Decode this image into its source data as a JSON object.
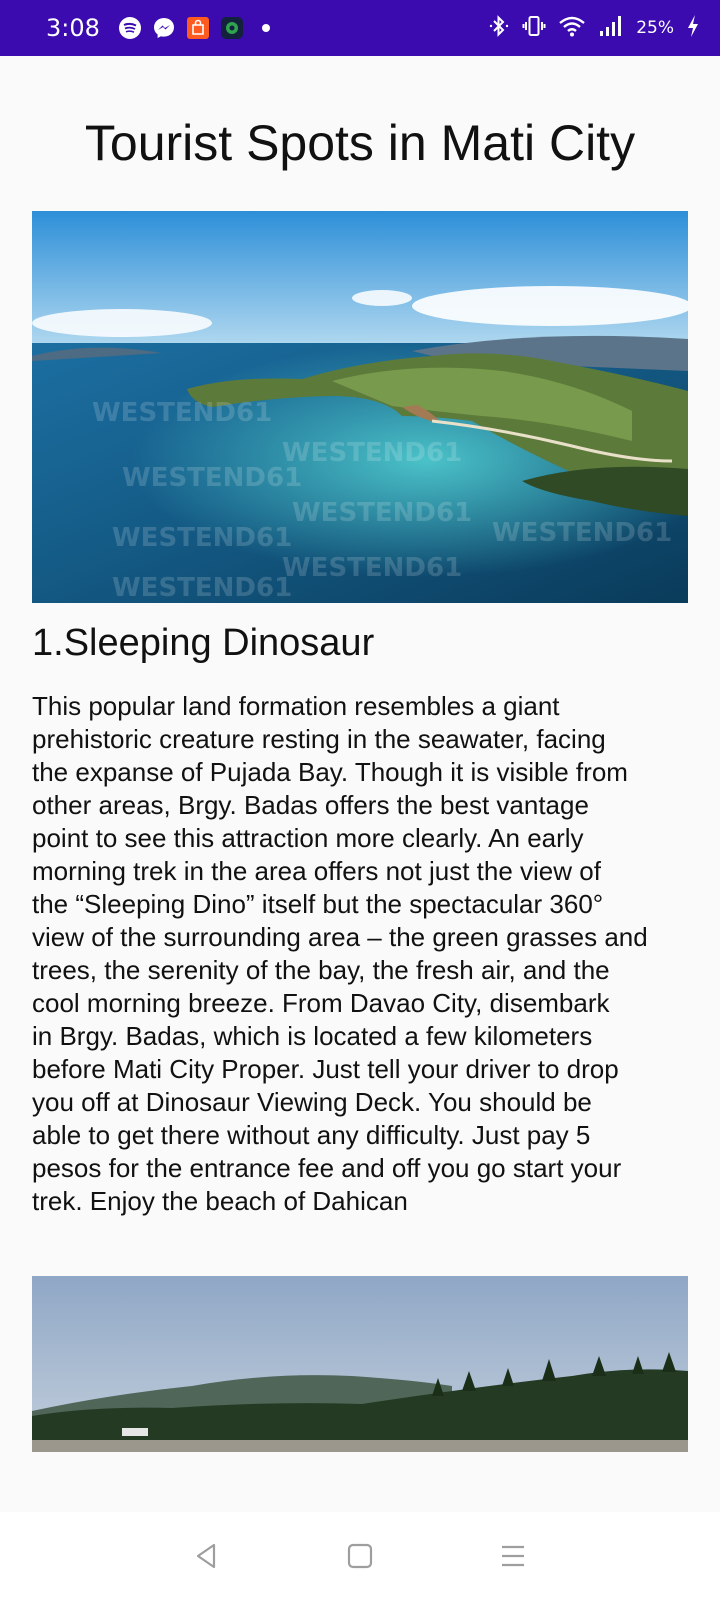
{
  "status_bar": {
    "time": "3:08",
    "battery_percent": "25%",
    "notification_icons": [
      "spotify-icon",
      "messenger-icon",
      "shopping-bag-icon",
      "app-icon",
      "dot-icon"
    ],
    "system_icons": [
      "bluetooth-icon",
      "vibrate-icon",
      "wifi-icon",
      "signal-icon",
      "charging-icon"
    ],
    "background_color": "#3b0bb0"
  },
  "page": {
    "title": "Tourist Spots in Mati City"
  },
  "spots": [
    {
      "title": "1.Sleeping Dinosaur",
      "description": "This popular land formation resembles a giant\nprehistoric creature resting in the seawater, facing\nthe expanse of Pujada Bay. Though it is visible from\nother areas, Brgy. Badas offers the best vantage\npoint to see this attraction more clearly. An early\nmorning trek in the area offers not just the view of\nthe “Sleeping Dino” itself but the spectacular 360°\nview of the surrounding area – the green grasses and\ntrees, the serenity of the bay, the fresh air, and the\ncool morning breeze. From Davao City, disembark\nin Brgy. Badas, which is located a few kilometers\nbefore Mati City Proper. Just tell your driver to drop\nyou off at Dinosaur Viewing Deck. You should be\nable to get there without any difficulty. Just pay 5\npesos for the entrance fee and off you go start your\ntrek. Enjoy the beach of Dahican",
      "image": "aerial-island-bay-photo",
      "watermark": "WESTEND61"
    },
    {
      "image": "beach-coconut-trees-photo"
    }
  ],
  "nav_bar": {
    "buttons": [
      "back-icon",
      "home-icon",
      "menu-icon"
    ]
  }
}
